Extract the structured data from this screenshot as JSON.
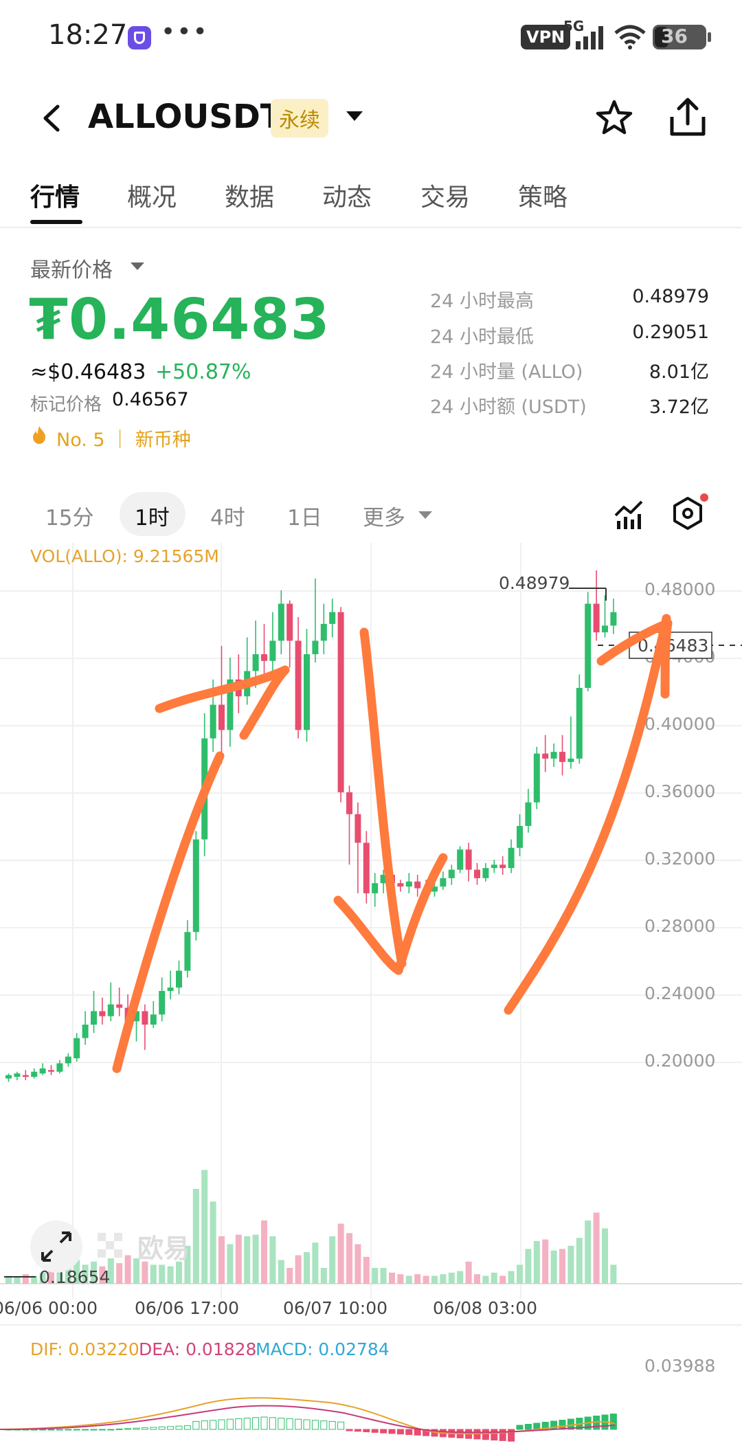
{
  "status_bar": {
    "time": "18:27",
    "dots": "•••",
    "vpn": "VPN",
    "network": "5G",
    "battery": "36"
  },
  "header": {
    "pair": "ALLOUSDT",
    "badge": "永续"
  },
  "tabs": [
    "行情",
    "概况",
    "数据",
    "动态",
    "交易",
    "策略"
  ],
  "price": {
    "label": "最新价格",
    "value": "₮0.46483",
    "usd": "≈$0.46483",
    "change": "+50.87%",
    "mark_label": "标记价格",
    "mark_value": "0.46567",
    "rank": "No. 5 ｜ 新币种"
  },
  "stats": [
    {
      "label": "24 小时最高",
      "value": "0.48979"
    },
    {
      "label": "24 小时最低",
      "value": "0.29051"
    },
    {
      "label": "24 小时量 (ALLO)",
      "value": "8.01亿"
    },
    {
      "label": "24 小时额 (USDT)",
      "value": "3.72亿"
    }
  ],
  "intervals": [
    "15分",
    "1时",
    "4时",
    "1日",
    "更多"
  ],
  "chart_data": {
    "type": "candlestick",
    "vol_label": "VOL(ALLO): 9.21565M",
    "y_ticks": [
      "0.48000",
      "0.44000",
      "0.40000",
      "0.36000",
      "0.32000",
      "0.28000",
      "0.24000",
      "0.20000"
    ],
    "x_ticks": [
      "06/06 00:00",
      "06/06 17:00",
      "06/07 10:00",
      "06/08 03:00"
    ],
    "ylim": [
      0.175,
      0.5
    ],
    "max_label": "0.48979",
    "min_label": "0.18654",
    "current_price_label": "0.46483",
    "watermark": "欧易",
    "macd_label": {
      "dif": "DIF: 0.03220",
      "dea": "DEA: 0.01828",
      "macd": "MACD: 0.02784"
    },
    "macd_axis": "0.03988",
    "colors": {
      "up": "#2ebd6b",
      "down": "#e84d6f",
      "annotation": "#ff7a3d"
    },
    "candles": [
      [
        0.188,
        0.19,
        0.186,
        0.191
      ],
      [
        0.189,
        0.191,
        0.187,
        0.192
      ],
      [
        0.19,
        0.189,
        0.187,
        0.193
      ],
      [
        0.189,
        0.192,
        0.188,
        0.194
      ],
      [
        0.191,
        0.194,
        0.19,
        0.197
      ],
      [
        0.193,
        0.192,
        0.19,
        0.196
      ],
      [
        0.192,
        0.197,
        0.191,
        0.199
      ],
      [
        0.197,
        0.201,
        0.195,
        0.203
      ],
      [
        0.2,
        0.212,
        0.198,
        0.215
      ],
      [
        0.212,
        0.22,
        0.208,
        0.228
      ],
      [
        0.22,
        0.228,
        0.215,
        0.24
      ],
      [
        0.228,
        0.225,
        0.22,
        0.236
      ],
      [
        0.225,
        0.232,
        0.222,
        0.245
      ],
      [
        0.232,
        0.23,
        0.225,
        0.242
      ],
      [
        0.23,
        0.222,
        0.218,
        0.238
      ],
      [
        0.222,
        0.228,
        0.21,
        0.235
      ],
      [
        0.228,
        0.22,
        0.205,
        0.232
      ],
      [
        0.22,
        0.226,
        0.218,
        0.234
      ],
      [
        0.226,
        0.24,
        0.222,
        0.248
      ],
      [
        0.24,
        0.242,
        0.235,
        0.252
      ],
      [
        0.242,
        0.252,
        0.238,
        0.258
      ],
      [
        0.252,
        0.275,
        0.248,
        0.282
      ],
      [
        0.275,
        0.33,
        0.27,
        0.335
      ],
      [
        0.33,
        0.39,
        0.32,
        0.405
      ],
      [
        0.39,
        0.41,
        0.382,
        0.425
      ],
      [
        0.41,
        0.395,
        0.375,
        0.445
      ],
      [
        0.395,
        0.425,
        0.385,
        0.438
      ],
      [
        0.425,
        0.415,
        0.405,
        0.44
      ],
      [
        0.415,
        0.43,
        0.41,
        0.45
      ],
      [
        0.43,
        0.44,
        0.42,
        0.46
      ],
      [
        0.44,
        0.436,
        0.425,
        0.458
      ],
      [
        0.436,
        0.448,
        0.43,
        0.465
      ],
      [
        0.448,
        0.47,
        0.44,
        0.478
      ],
      [
        0.47,
        0.448,
        0.432,
        0.472
      ],
      [
        0.448,
        0.395,
        0.39,
        0.462
      ],
      [
        0.395,
        0.44,
        0.388,
        0.455
      ],
      [
        0.44,
        0.448,
        0.435,
        0.485
      ],
      [
        0.448,
        0.458,
        0.44,
        0.47
      ],
      [
        0.458,
        0.465,
        0.45,
        0.473
      ],
      [
        0.465,
        0.358,
        0.352,
        0.468
      ],
      [
        0.358,
        0.345,
        0.315,
        0.362
      ],
      [
        0.345,
        0.328,
        0.298,
        0.352
      ],
      [
        0.328,
        0.298,
        0.292,
        0.335
      ],
      [
        0.298,
        0.304,
        0.29,
        0.31
      ],
      [
        0.304,
        0.309,
        0.298,
        0.312
      ],
      [
        0.309,
        0.304,
        0.3,
        0.313
      ],
      [
        0.304,
        0.302,
        0.299,
        0.306
      ],
      [
        0.302,
        0.305,
        0.298,
        0.31
      ],
      [
        0.305,
        0.301,
        0.296,
        0.309
      ],
      [
        0.301,
        0.299,
        0.294,
        0.306
      ],
      [
        0.299,
        0.302,
        0.296,
        0.305
      ],
      [
        0.302,
        0.307,
        0.3,
        0.311
      ],
      [
        0.307,
        0.312,
        0.303,
        0.315
      ],
      [
        0.312,
        0.324,
        0.31,
        0.326
      ],
      [
        0.324,
        0.312,
        0.305,
        0.328
      ],
      [
        0.312,
        0.307,
        0.303,
        0.316
      ],
      [
        0.307,
        0.313,
        0.305,
        0.316
      ],
      [
        0.313,
        0.315,
        0.31,
        0.318
      ],
      [
        0.315,
        0.313,
        0.309,
        0.32
      ],
      [
        0.313,
        0.325,
        0.31,
        0.33
      ],
      [
        0.325,
        0.338,
        0.32,
        0.345
      ],
      [
        0.338,
        0.352,
        0.334,
        0.36
      ],
      [
        0.352,
        0.381,
        0.348,
        0.385
      ],
      [
        0.381,
        0.378,
        0.37,
        0.392
      ],
      [
        0.378,
        0.382,
        0.373,
        0.387
      ],
      [
        0.382,
        0.376,
        0.368,
        0.392
      ],
      [
        0.376,
        0.378,
        0.372,
        0.403
      ],
      [
        0.378,
        0.42,
        0.375,
        0.428
      ],
      [
        0.42,
        0.47,
        0.418,
        0.477
      ],
      [
        0.47,
        0.453,
        0.448,
        0.4898
      ],
      [
        0.453,
        0.457,
        0.45,
        0.475
      ],
      [
        0.457,
        0.465,
        0.452,
        0.473
      ]
    ],
    "volumes": [
      0.05,
      0.04,
      0.06,
      0.05,
      0.07,
      0.08,
      0.07,
      0.1,
      0.15,
      0.12,
      0.14,
      0.11,
      0.16,
      0.13,
      0.18,
      0.16,
      0.14,
      0.12,
      0.12,
      0.11,
      0.14,
      0.24,
      0.6,
      0.72,
      0.52,
      0.3,
      0.25,
      0.31,
      0.3,
      0.31,
      0.4,
      0.3,
      0.15,
      0.1,
      0.18,
      0.2,
      0.26,
      0.1,
      0.3,
      0.38,
      0.32,
      0.25,
      0.17,
      0.1,
      0.1,
      0.07,
      0.06,
      0.05,
      0.06,
      0.05,
      0.05,
      0.06,
      0.07,
      0.08,
      0.14,
      0.06,
      0.05,
      0.07,
      0.05,
      0.08,
      0.12,
      0.22,
      0.27,
      0.28,
      0.21,
      0.22,
      0.24,
      0.29,
      0.4,
      0.45,
      0.35,
      0.12
    ]
  }
}
